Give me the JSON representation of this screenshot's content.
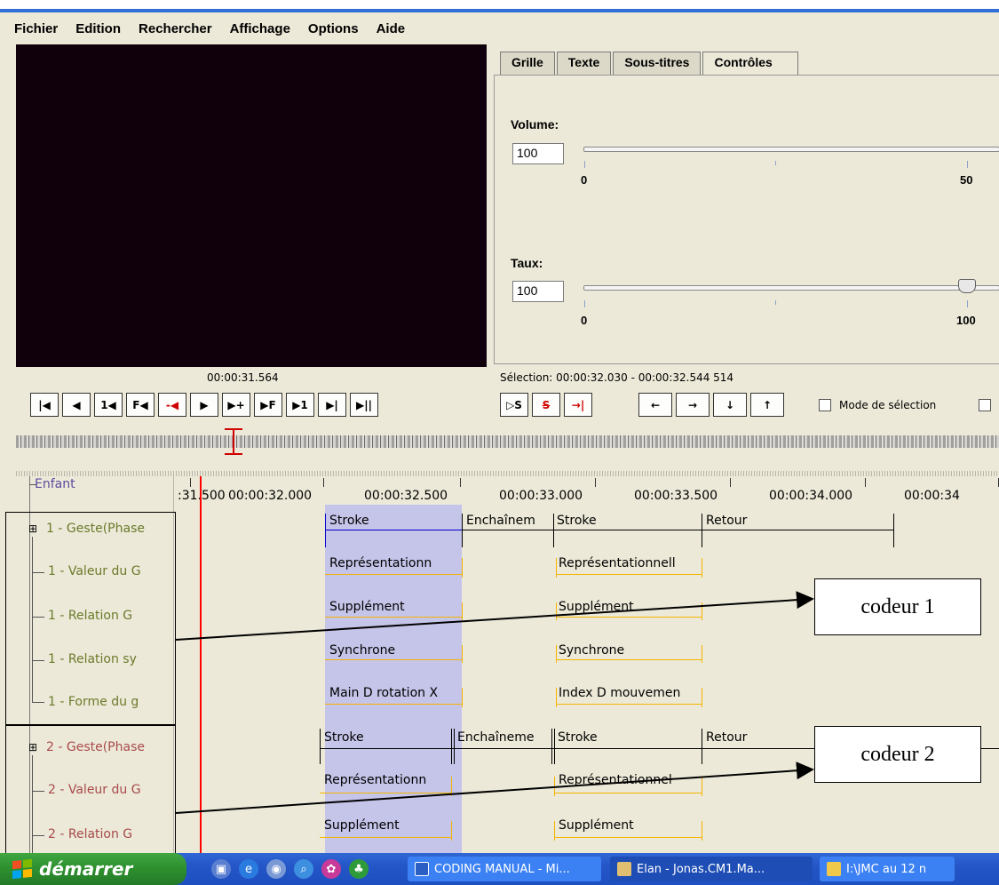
{
  "menu": [
    "Fichier",
    "Edition",
    "Rechercher",
    "Affichage",
    "Options",
    "Aide"
  ],
  "tabs": [
    "Grille",
    "Texte",
    "Sous-titres",
    "Contrôles"
  ],
  "controls": {
    "volume_label": "Volume:",
    "volume_value": "100",
    "volume_ticks": [
      "0",
      "50"
    ],
    "rate_label": "Taux:",
    "rate_value": "100",
    "rate_ticks": [
      "0",
      "100"
    ],
    "rate_level_percent": 100
  },
  "media_time": "00:00:31.564",
  "selection": "Sélection: 00:00:32.030 - 00:00:32.544  514",
  "player_buttons": [
    "|◀",
    "◀",
    "1◀",
    "F◀",
    "-◀",
    "▶",
    "▶+",
    "▶F",
    "▶1",
    "▶|",
    "▶||"
  ],
  "selection_buttons": [
    "▷S",
    "S",
    "→|"
  ],
  "nav_buttons": [
    "←",
    "→",
    "↓",
    "↑"
  ],
  "selection_mode_label": "Mode de sélection",
  "ruler": {
    "labels": [
      ":31.500",
      "00:00:32.000",
      "00:00:32.500",
      "00:00:33.000",
      "00:00:33.500",
      "00:00:34.000",
      "00:00:34"
    ],
    "top_tier": "Enfant"
  },
  "tiers": [
    "1 - Geste(Phase",
    "1 - Valeur du G",
    "1 - Relation G",
    "1 - Relation sy",
    "1 - Forme du g",
    "2 - Geste(Phase",
    "2 - Valeur du G",
    "2 - Relation G"
  ],
  "annotations": {
    "r1": [
      "Stroke",
      "Enchaînem",
      "Stroke",
      "Retour"
    ],
    "r2": [
      "Représentationn",
      "Représentationnell"
    ],
    "r3": [
      "Supplément",
      "Supplément"
    ],
    "r4": [
      "Synchrone",
      "Synchrone"
    ],
    "r5": [
      "Main D rotation X",
      "Index D mouvemen"
    ],
    "r6": [
      "Stroke",
      "Enchaîneme",
      "Stroke",
      "Retour"
    ],
    "r7": [
      "Représentationn",
      "Représentationnel"
    ],
    "r8": [
      "Supplément",
      "Supplément"
    ]
  },
  "callouts": [
    "codeur 1",
    "codeur 2"
  ],
  "taskbar": {
    "start": "démarrer",
    "tasks": [
      "CODING MANUAL - Mi...",
      "Elan - Jonas.CM1.Ma...",
      "I:\\JMC au 12 n"
    ]
  },
  "colors": {
    "selection": "#9696ff",
    "crosshair": "#ff0000",
    "dependent_tier_line": "#f5b400",
    "tier1_label": "#6b7a2a",
    "tier2_label": "#a84a4a",
    "top_tier_label": "#5b4aa0"
  }
}
